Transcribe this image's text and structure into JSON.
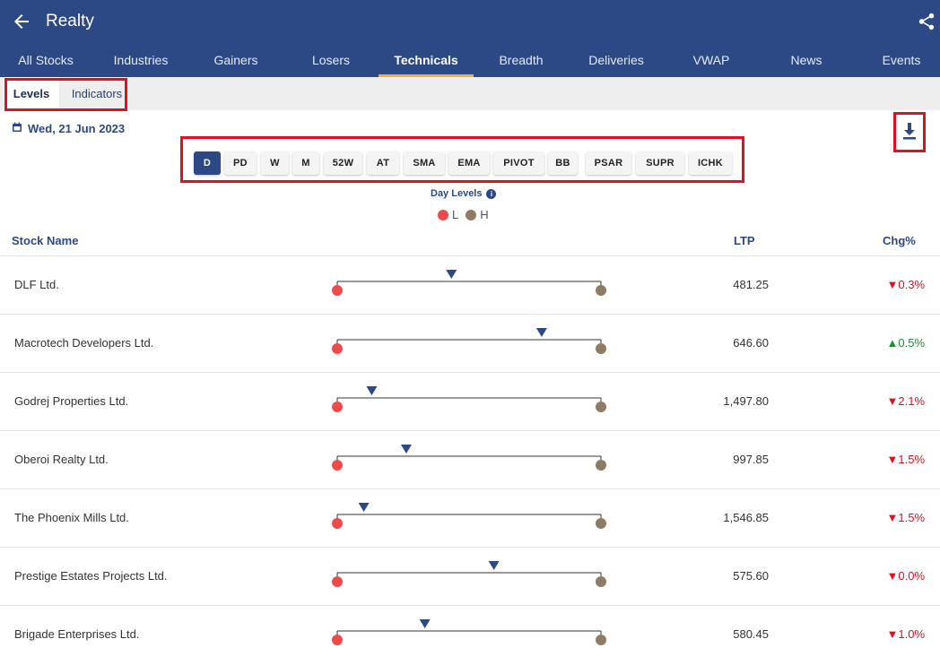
{
  "header": {
    "title": "Realty"
  },
  "nav_tabs": [
    {
      "label": "All Stocks",
      "active": false
    },
    {
      "label": "Industries",
      "active": false
    },
    {
      "label": "Gainers",
      "active": false
    },
    {
      "label": "Losers",
      "active": false
    },
    {
      "label": "Technicals",
      "active": true
    },
    {
      "label": "Breadth",
      "active": false
    },
    {
      "label": "Deliveries",
      "active": false
    },
    {
      "label": "VWAP",
      "active": false
    },
    {
      "label": "News",
      "active": false
    },
    {
      "label": "Events",
      "active": false
    }
  ],
  "sub_tabs": [
    {
      "label": "Levels",
      "active": true
    },
    {
      "label": "Indicators",
      "active": false
    }
  ],
  "date": "Wed, 21 Jun 2023",
  "level_chips": [
    {
      "label": "D",
      "active": true
    },
    {
      "label": "PD",
      "active": false
    },
    {
      "label": "W",
      "active": false
    },
    {
      "label": "M",
      "active": false
    },
    {
      "label": "52W",
      "active": false
    },
    {
      "label": "AT",
      "active": false
    },
    {
      "label": "SMA",
      "active": false
    },
    {
      "label": "EMA",
      "active": false
    },
    {
      "label": "PIVOT",
      "active": false
    },
    {
      "label": "BB",
      "active": false
    },
    {
      "label": "PSAR",
      "active": false
    },
    {
      "label": "SUPR",
      "active": false
    },
    {
      "label": "ICHK",
      "active": false
    }
  ],
  "levels_title": "Day Levels",
  "legend": {
    "low": "L",
    "high": "H",
    "low_color": "#ef4b4b",
    "high_color": "#8f7b63",
    "marker_color": "#2c4885"
  },
  "table": {
    "headers": {
      "name": "Stock Name",
      "ltp": "LTP",
      "chg": "Chg%"
    },
    "rows": [
      {
        "name": "DLF Ltd.",
        "ltp": "481.25",
        "chg": "▼0.3%",
        "direction": "down",
        "position": 0.43
      },
      {
        "name": "Macrotech Developers Ltd.",
        "ltp": "646.60",
        "chg": "▲0.5%",
        "direction": "up",
        "position": 0.77
      },
      {
        "name": "Godrej Properties Ltd.",
        "ltp": "1,497.80",
        "chg": "▼2.1%",
        "direction": "down",
        "position": 0.13
      },
      {
        "name": "Oberoi Realty Ltd.",
        "ltp": "997.85",
        "chg": "▼1.5%",
        "direction": "down",
        "position": 0.26
      },
      {
        "name": "The Phoenix Mills Ltd.",
        "ltp": "1,546.85",
        "chg": "▼1.5%",
        "direction": "down",
        "position": 0.1
      },
      {
        "name": "Prestige Estates Projects Ltd.",
        "ltp": "575.60",
        "chg": "▼0.0%",
        "direction": "down",
        "position": 0.59
      },
      {
        "name": "Brigade Enterprises Ltd.",
        "ltp": "580.45",
        "chg": "▼1.0%",
        "direction": "down",
        "position": 0.33
      }
    ]
  }
}
